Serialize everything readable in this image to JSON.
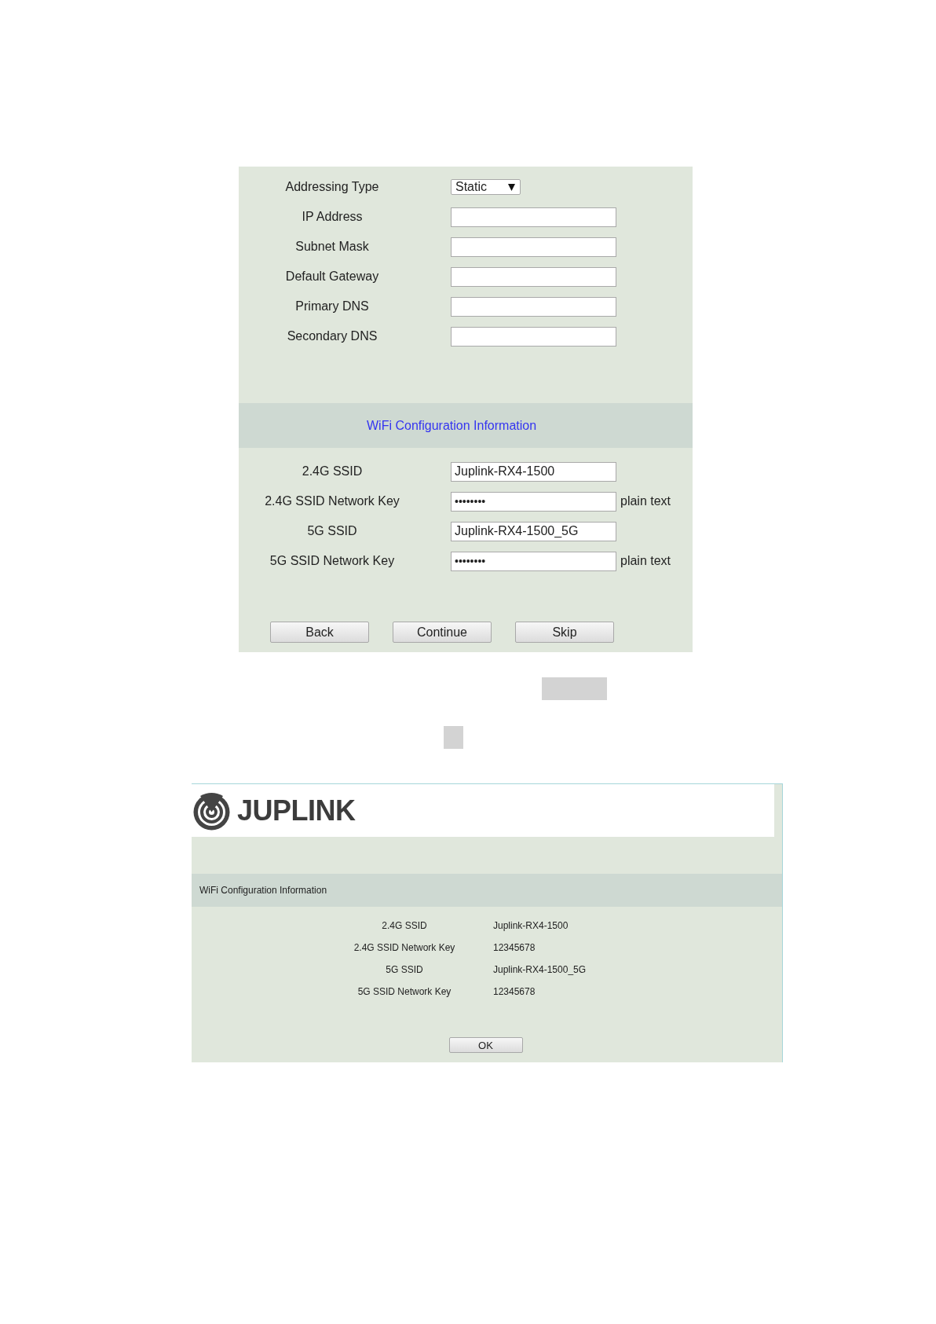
{
  "network_settings": {
    "fields": [
      {
        "label": "Addressing Type",
        "kind": "select",
        "value": "Static"
      },
      {
        "label": "IP Address",
        "kind": "text"
      },
      {
        "label": "Subnet Mask",
        "kind": "text"
      },
      {
        "label": "Default Gateway",
        "kind": "text"
      },
      {
        "label": "Primary DNS",
        "kind": "text"
      },
      {
        "label": "Secondary DNS",
        "kind": "text"
      }
    ]
  },
  "wifi_section": {
    "title": "WiFi Configuration Information",
    "fields": [
      {
        "label": "2.4G SSID",
        "kind": "text",
        "value": "Juplink-RX4-1500"
      },
      {
        "label": "2.4G SSID Network Key",
        "kind": "password",
        "value": "••••••••",
        "suffix": "plain text"
      },
      {
        "label": "5G SSID",
        "kind": "text",
        "value": "Juplink-RX4-1500_5G"
      },
      {
        "label": "5G SSID Network Key",
        "kind": "password",
        "value": "••••••••",
        "suffix": "plain text"
      }
    ]
  },
  "buttons": [
    {
      "label": "Back"
    },
    {
      "label": "Continue"
    },
    {
      "label": "Skip"
    }
  ],
  "summary_page": {
    "brand": "JUPLINK",
    "section_title": "WiFi Configuration Information",
    "rows": [
      {
        "label": "2.4G SSID",
        "value": "Juplink-RX4-1500"
      },
      {
        "label": "2.4G SSID Network Key",
        "value": "12345678"
      },
      {
        "label": "5G SSID",
        "value": "Juplink-RX4-1500_5G"
      },
      {
        "label": "5G SSID Network Key",
        "value": "12345678"
      }
    ],
    "button": "OK"
  }
}
